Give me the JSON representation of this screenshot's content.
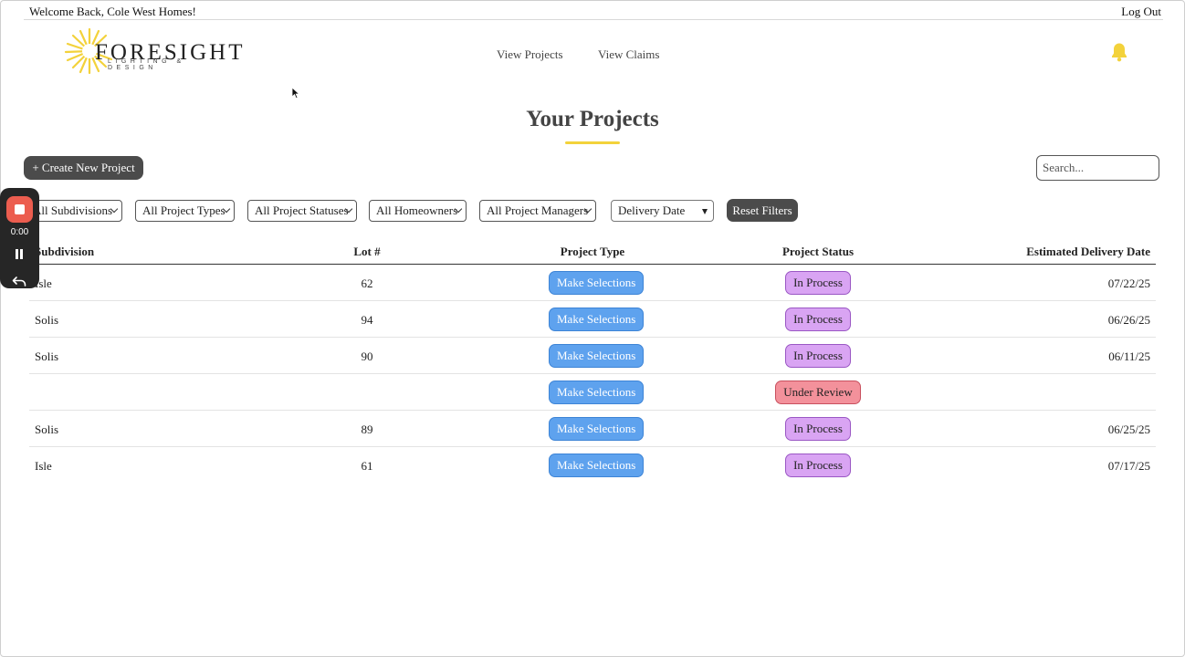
{
  "topbar": {
    "welcome": "Welcome Back, Cole West Homes!",
    "logout": "Log Out"
  },
  "logo": {
    "word": "FORESIGHT",
    "sub": "LIGHTING & DESIGN",
    "accent": "#f3d23b"
  },
  "nav": {
    "projects": "View Projects",
    "claims": "View Claims"
  },
  "page": {
    "title": "Your Projects"
  },
  "controls": {
    "create_label": "+ Create New Project",
    "search_placeholder": "Search...",
    "reset_label": "Reset Filters"
  },
  "filters": {
    "subdivision": "All Subdivisions",
    "project_type": "All Project Types",
    "project_status": "All Project Statuses",
    "homeowner": "All Homeowners",
    "project_manager": "All Project Managers",
    "delivery_date": "Delivery Date"
  },
  "table": {
    "headers": {
      "subdivision": "Subdivision",
      "lot": "Lot #",
      "project_type": "Project Type",
      "project_status": "Project Status",
      "delivery": "Estimated Delivery Date"
    },
    "rows": [
      {
        "subdivision": "Isle",
        "lot": "62",
        "project_type": "Make Selections",
        "status": "In Process",
        "date": "07/22/25"
      },
      {
        "subdivision": "Solis",
        "lot": "94",
        "project_type": "Make Selections",
        "status": "In Process",
        "date": "06/26/25"
      },
      {
        "subdivision": "Solis",
        "lot": "90",
        "project_type": "Make Selections",
        "status": "In Process",
        "date": "06/11/25"
      },
      {
        "subdivision": "",
        "lot": "",
        "project_type": "Make Selections",
        "status": "Under Review",
        "date": ""
      },
      {
        "subdivision": "Solis",
        "lot": "89",
        "project_type": "Make Selections",
        "status": "In Process",
        "date": "06/25/25"
      },
      {
        "subdivision": "Isle",
        "lot": "61",
        "project_type": "Make Selections",
        "status": "In Process",
        "date": "07/17/25"
      }
    ]
  },
  "status_colors": {
    "In Process": "#d9a4f3",
    "Under Review": "#f3919b"
  },
  "recorder": {
    "time": "0:00"
  }
}
